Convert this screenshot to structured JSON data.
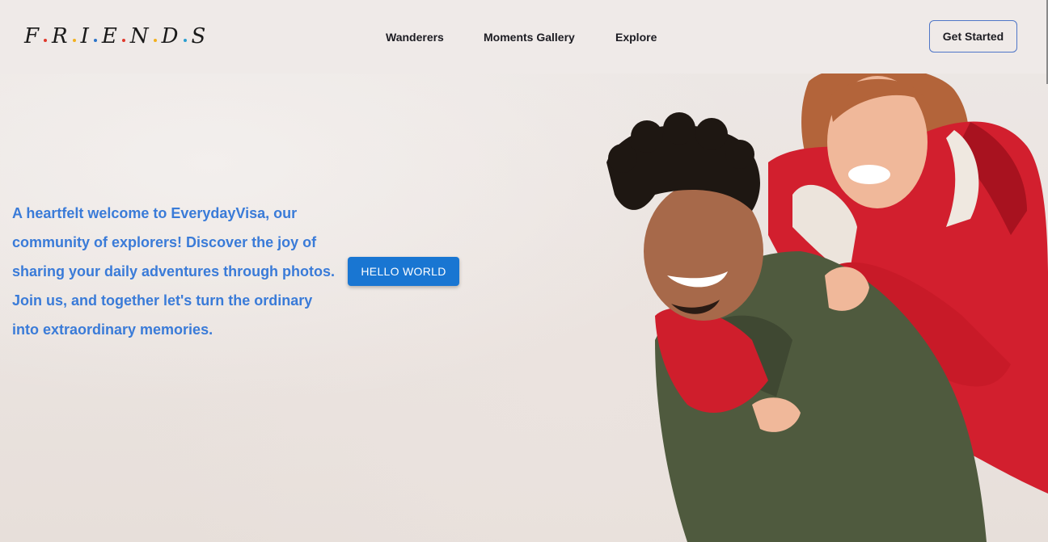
{
  "header": {
    "logo": {
      "letters": [
        "F",
        "R",
        "I",
        "E",
        "N",
        "D",
        "S"
      ],
      "dot_colors": [
        "#e0382b",
        "#f2b01e",
        "#2b73c9",
        "#e0382b",
        "#f2b01e",
        "#2b9fd0"
      ]
    },
    "nav": [
      {
        "label": "Wanderers"
      },
      {
        "label": "Moments Gallery"
      },
      {
        "label": "Explore"
      }
    ],
    "cta_label": "Get Started"
  },
  "hero": {
    "intro_text": "A heartfelt welcome to EverydayVisa, our community of explorers! Discover the joy of sharing your daily adventures through photos. Join us, and together let's turn the ordinary into extraordinary memories.",
    "button_label": "HELLO WORLD"
  },
  "colors": {
    "accent_text": "#3a7bd8",
    "button_bg": "#1976d2",
    "cta_border": "#4f76c7",
    "jacket_red": "#d21f2e",
    "jacket_green": "#4f5a3e"
  }
}
